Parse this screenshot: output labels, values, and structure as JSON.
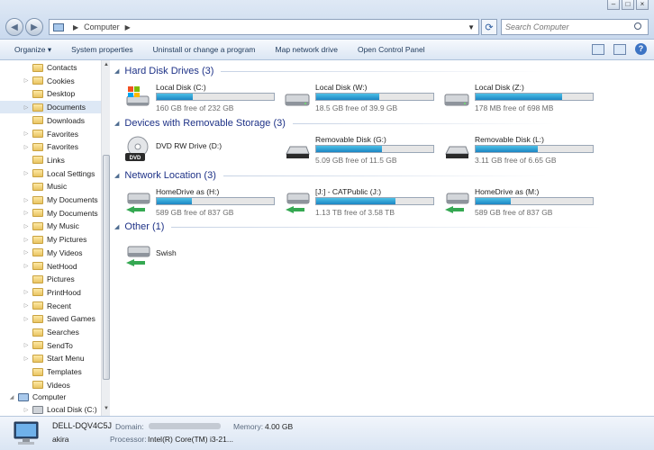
{
  "address": {
    "crumb": "Computer"
  },
  "search": {
    "placeholder": "Search Computer"
  },
  "toolbar": {
    "items": [
      "Organize",
      "System properties",
      "Uninstall or change a program",
      "Map network drive",
      "Open Control Panel"
    ]
  },
  "sidebar": {
    "items": [
      {
        "label": "Contacts"
      },
      {
        "label": "Cookies"
      },
      {
        "label": "Desktop"
      },
      {
        "label": "Documents"
      },
      {
        "label": "Downloads"
      },
      {
        "label": "Favorites"
      },
      {
        "label": "Favorites"
      },
      {
        "label": "Links"
      },
      {
        "label": "Local Settings"
      },
      {
        "label": "Music"
      },
      {
        "label": "My Documents"
      },
      {
        "label": "My Documents"
      },
      {
        "label": "My Music"
      },
      {
        "label": "My Pictures"
      },
      {
        "label": "My Videos"
      },
      {
        "label": "NetHood"
      },
      {
        "label": "Pictures"
      },
      {
        "label": "PrintHood"
      },
      {
        "label": "Recent"
      },
      {
        "label": "Saved Games"
      },
      {
        "label": "Searches"
      },
      {
        "label": "SendTo"
      },
      {
        "label": "Start Menu"
      },
      {
        "label": "Templates"
      },
      {
        "label": "Videos"
      },
      {
        "label": "Computer"
      },
      {
        "label": "Local Disk (C:)"
      }
    ]
  },
  "groups": {
    "hard_disks": {
      "title": "Hard Disk Drives (3)",
      "drives": [
        {
          "name": "Local Disk (C:)",
          "free": "160 GB free of 232 GB",
          "used_fraction": 0.31
        },
        {
          "name": "Local Disk (W:)",
          "free": "18.5 GB free of 39.9 GB",
          "used_fraction": 0.54
        },
        {
          "name": "Local Disk (Z:)",
          "free": "178 MB free of 698 MB",
          "used_fraction": 0.74
        }
      ]
    },
    "removable": {
      "title": "Devices with Removable Storage (3)",
      "drives": [
        {
          "name": "DVD RW Drive (D:)",
          "dvd_label": "DVD"
        },
        {
          "name": "Removable Disk (G:)",
          "free": "5.09 GB free of 11.5 GB",
          "used_fraction": 0.56
        },
        {
          "name": "Removable Disk (L:)",
          "free": "3.11 GB free of 6.65 GB",
          "used_fraction": 0.53
        }
      ]
    },
    "network": {
      "title": "Network Location (3)",
      "drives": [
        {
          "name": "HomeDrive as (H:)",
          "free": "589 GB free of 837 GB",
          "used_fraction": 0.3
        },
        {
          "name": "[J:] - CATPublic (J:)",
          "free": "1.13 TB free of 3.58 TB",
          "used_fraction": 0.68
        },
        {
          "name": "HomeDrive as (M:)",
          "free": "589 GB free of 837 GB",
          "used_fraction": 0.3
        }
      ]
    },
    "other": {
      "title": "Other (1)",
      "items": [
        {
          "name": "Swish"
        }
      ]
    }
  },
  "details": {
    "computer_name": "DELL-DQV4C5J",
    "user": "akira",
    "domain_label": "Domain:",
    "memory_label": "Memory:",
    "memory_value": "4.00 GB",
    "processor_label": "Processor:",
    "processor_value": "Intel(R) Core(TM) i3-21..."
  },
  "colors": {
    "bar_fill": "#1b86c4",
    "group_title": "#1e3287"
  }
}
